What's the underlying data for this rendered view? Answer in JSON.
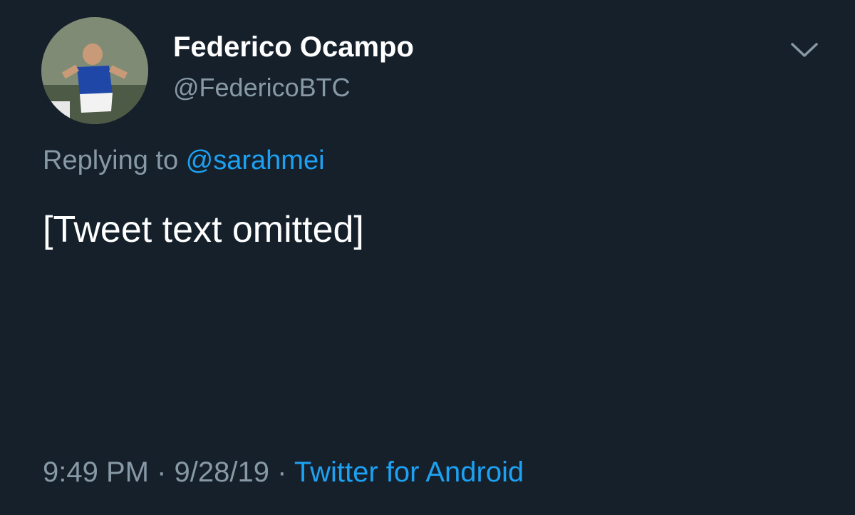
{
  "tweet": {
    "author_name": "Federico Ocampo",
    "author_handle": "@FedericoBTC",
    "reply_prefix": "Replying to ",
    "reply_to": "@sarahmei",
    "body": "[Tweet text omitted]",
    "time": "9:49 PM",
    "separator": "·",
    "date": "9/28/19",
    "source": "Twitter for Android"
  },
  "icons": {
    "menu": "chevron-down-icon",
    "avatar": "profile-photo"
  },
  "colors": {
    "background": "#15202b",
    "primary_text": "#ffffff",
    "secondary_text": "#8899a6",
    "link": "#1da1f2"
  }
}
